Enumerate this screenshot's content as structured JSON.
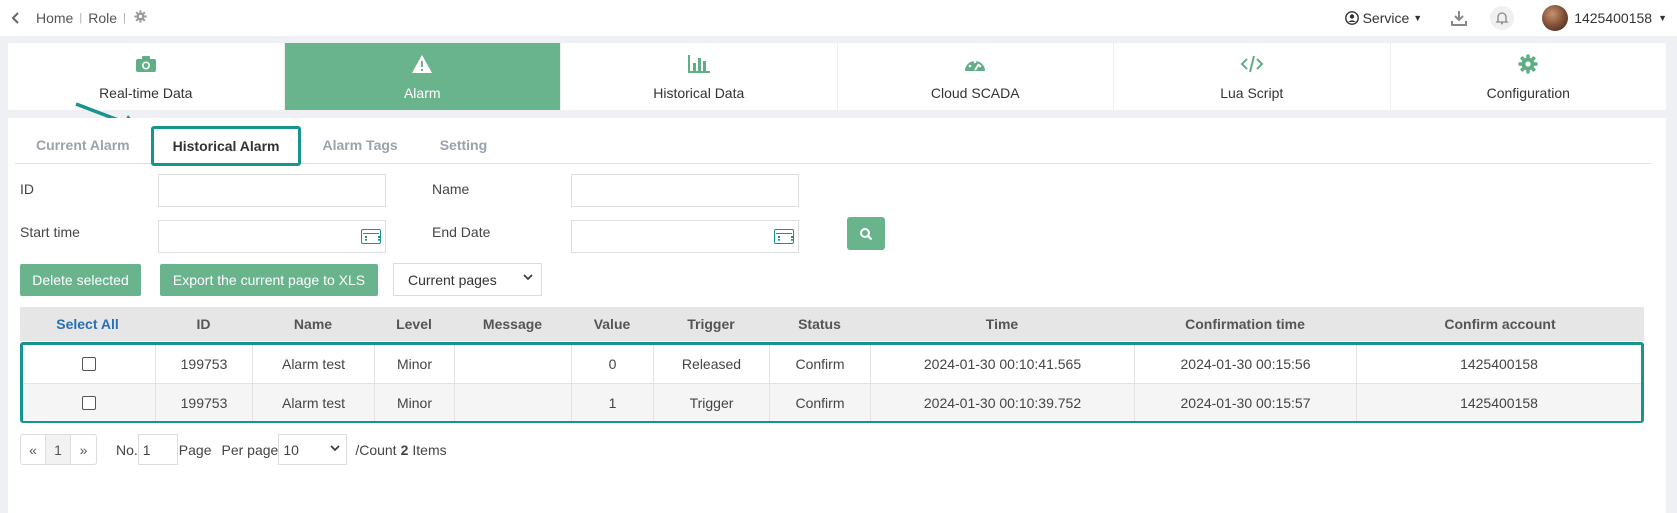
{
  "topbar": {
    "breadcrumb": [
      "Home",
      "Role"
    ],
    "service_label": "Service",
    "username": "1425400158",
    "icons": [
      "chevron-left-icon",
      "gear-icon",
      "user-circle-icon",
      "download-icon",
      "bell-icon"
    ]
  },
  "modules": [
    {
      "label": "Real-time Data",
      "icon": "camera-icon"
    },
    {
      "label": "Alarm",
      "icon": "warning-icon",
      "active": true
    },
    {
      "label": "Historical Data",
      "icon": "bar-chart-icon"
    },
    {
      "label": "Cloud SCADA",
      "icon": "dashboard-icon"
    },
    {
      "label": "Lua Script",
      "icon": "code-icon"
    },
    {
      "label": "Configuration",
      "icon": "gear-icon"
    }
  ],
  "subtabs": [
    {
      "label": "Current Alarm"
    },
    {
      "label": "Historical Alarm",
      "active": true
    },
    {
      "label": "Alarm Tags"
    },
    {
      "label": "Setting"
    }
  ],
  "form": {
    "id_label": "ID",
    "id_value": "",
    "name_label": "Name",
    "name_value": "",
    "start_label": "Start time",
    "start_value": "",
    "end_label": "End Date",
    "end_value": ""
  },
  "actions": {
    "delete_label": "Delete selected",
    "export_label": "Export the current page to XLS",
    "scope_value": "Current pages"
  },
  "table": {
    "columns": [
      "Select All",
      "ID",
      "Name",
      "Level",
      "Message",
      "Value",
      "Trigger",
      "Status",
      "Time",
      "Confirmation time",
      "Confirm account"
    ],
    "rows": [
      [
        "",
        "199753",
        "Alarm test",
        "Minor",
        "",
        "0",
        "Released",
        "Confirm",
        "2024-01-30 00:10:41.565",
        "2024-01-30 00:15:56",
        "1425400158"
      ],
      [
        "",
        "199753",
        "Alarm test",
        "Minor",
        "",
        "1",
        "Trigger",
        "Confirm",
        "2024-01-30 00:10:39.752",
        "2024-01-30 00:15:57",
        "1425400158"
      ]
    ]
  },
  "pager": {
    "prev": "«",
    "page": "1",
    "next": "»",
    "no_label": "No.",
    "page_input": "1",
    "page_label": "Page",
    "per_page_label": "Per page",
    "per_page_value": "10",
    "count_prefix": "/Count",
    "count": "2",
    "count_suffix": "Items"
  },
  "colors": {
    "accent": "#6ab48d",
    "highlight": "#17948d",
    "link": "#2a6fb6"
  }
}
